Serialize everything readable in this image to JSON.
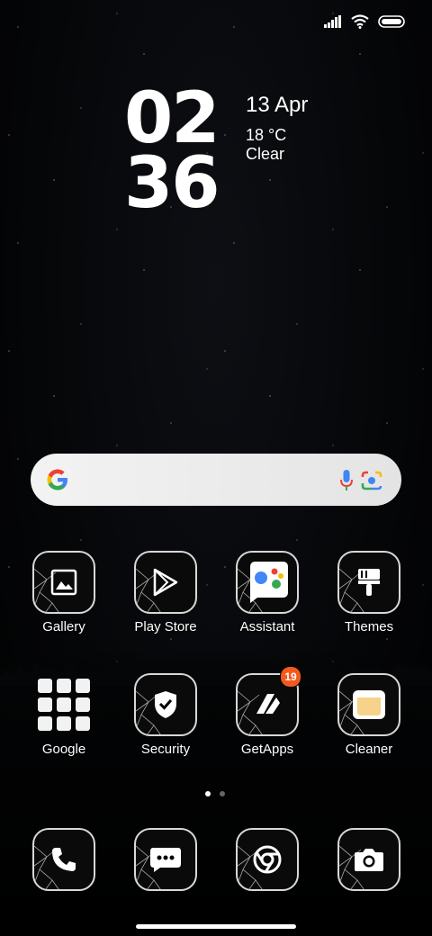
{
  "clock": {
    "hours": "02",
    "minutes": "36"
  },
  "weather": {
    "date": "13 Apr",
    "temperature": "18 °C",
    "condition": "Clear"
  },
  "search": {
    "placeholder": ""
  },
  "apps_row1": [
    {
      "label": "Gallery",
      "icon": "image-icon"
    },
    {
      "label": "Play Store",
      "icon": "play-store-icon"
    },
    {
      "label": "Assistant",
      "icon": "assistant-icon"
    },
    {
      "label": "Themes",
      "icon": "paintbrush-icon"
    }
  ],
  "apps_row2": [
    {
      "label": "Google",
      "icon": "folder-icon"
    },
    {
      "label": "Security",
      "icon": "shield-icon"
    },
    {
      "label": "GetApps",
      "icon": "getapps-icon",
      "badge": "19"
    },
    {
      "label": "Cleaner",
      "icon": "trash-icon"
    }
  ],
  "dock": [
    {
      "icon": "phone-icon"
    },
    {
      "icon": "messages-icon"
    },
    {
      "icon": "chrome-icon"
    },
    {
      "icon": "camera-icon"
    }
  ],
  "pages": {
    "count": 2,
    "current": 1
  },
  "colors": {
    "badge": "#f25a1d",
    "google_blue": "#4285F4",
    "google_red": "#EA4335",
    "google_yellow": "#FBBC05",
    "google_green": "#34A853"
  }
}
